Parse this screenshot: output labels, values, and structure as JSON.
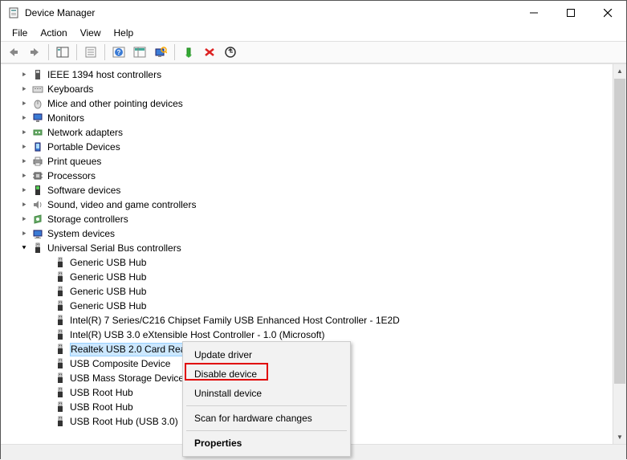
{
  "window": {
    "title": "Device Manager"
  },
  "menu": {
    "file": "File",
    "action": "Action",
    "view": "View",
    "help": "Help"
  },
  "tree": {
    "categories": [
      {
        "label": "IEEE 1394 host controllers",
        "icon": "ieee1394"
      },
      {
        "label": "Keyboards",
        "icon": "keyboard"
      },
      {
        "label": "Mice and other pointing devices",
        "icon": "mouse"
      },
      {
        "label": "Monitors",
        "icon": "monitor"
      },
      {
        "label": "Network adapters",
        "icon": "network"
      },
      {
        "label": "Portable Devices",
        "icon": "portable"
      },
      {
        "label": "Print queues",
        "icon": "printer"
      },
      {
        "label": "Processors",
        "icon": "cpu"
      },
      {
        "label": "Software devices",
        "icon": "software"
      },
      {
        "label": "Sound, video and game controllers",
        "icon": "sound"
      },
      {
        "label": "Storage controllers",
        "icon": "storage"
      },
      {
        "label": "System devices",
        "icon": "system"
      },
      {
        "label": "Universal Serial Bus controllers",
        "icon": "usb",
        "expanded": true
      }
    ],
    "usb_children": [
      "Generic USB Hub",
      "Generic USB Hub",
      "Generic USB Hub",
      "Generic USB Hub",
      "Intel(R) 7 Series/C216 Chipset Family USB Enhanced Host Controller - 1E2D",
      "Intel(R) USB 3.0 eXtensible Host Controller - 1.0 (Microsoft)",
      "Realtek USB 2.0 Card Reader",
      "USB Composite Device",
      "USB Mass Storage Device",
      "USB Root Hub",
      "USB Root Hub",
      "USB Root Hub (USB 3.0)"
    ],
    "selected_index": 6
  },
  "context_menu": {
    "update": "Update driver",
    "disable": "Disable device",
    "uninstall": "Uninstall device",
    "scan": "Scan for hardware changes",
    "properties": "Properties"
  }
}
